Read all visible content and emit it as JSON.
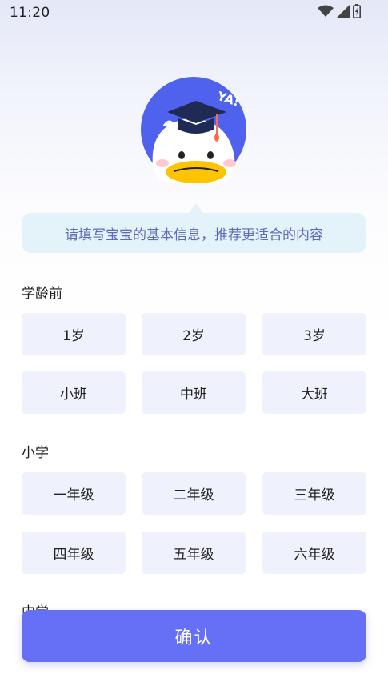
{
  "status_bar": {
    "time": "11:20",
    "wifi_icon": "wifi-icon",
    "signal_icon": "signal-icon",
    "battery_icon": "battery-icon"
  },
  "mascot": {
    "icon": "duck-graduate-icon",
    "badge_text": "YA!"
  },
  "tip": {
    "text": "请填写宝宝的基本信息，推荐更适合的内容"
  },
  "sections": {
    "preschool": {
      "title": "学龄前",
      "options": [
        "1岁",
        "2岁",
        "3岁",
        "小班",
        "中班",
        "大班"
      ]
    },
    "primary": {
      "title": "小学",
      "options": [
        "一年级",
        "二年级",
        "三年级",
        "四年级",
        "五年级",
        "六年级"
      ]
    },
    "middle": {
      "title": "中学"
    }
  },
  "confirm_button": {
    "label": "确认"
  },
  "colors": {
    "accent": "#6670f6",
    "option_bg": "#eff2fd",
    "tip_bg": "#e4f2fa",
    "tip_text": "#6169b8"
  }
}
